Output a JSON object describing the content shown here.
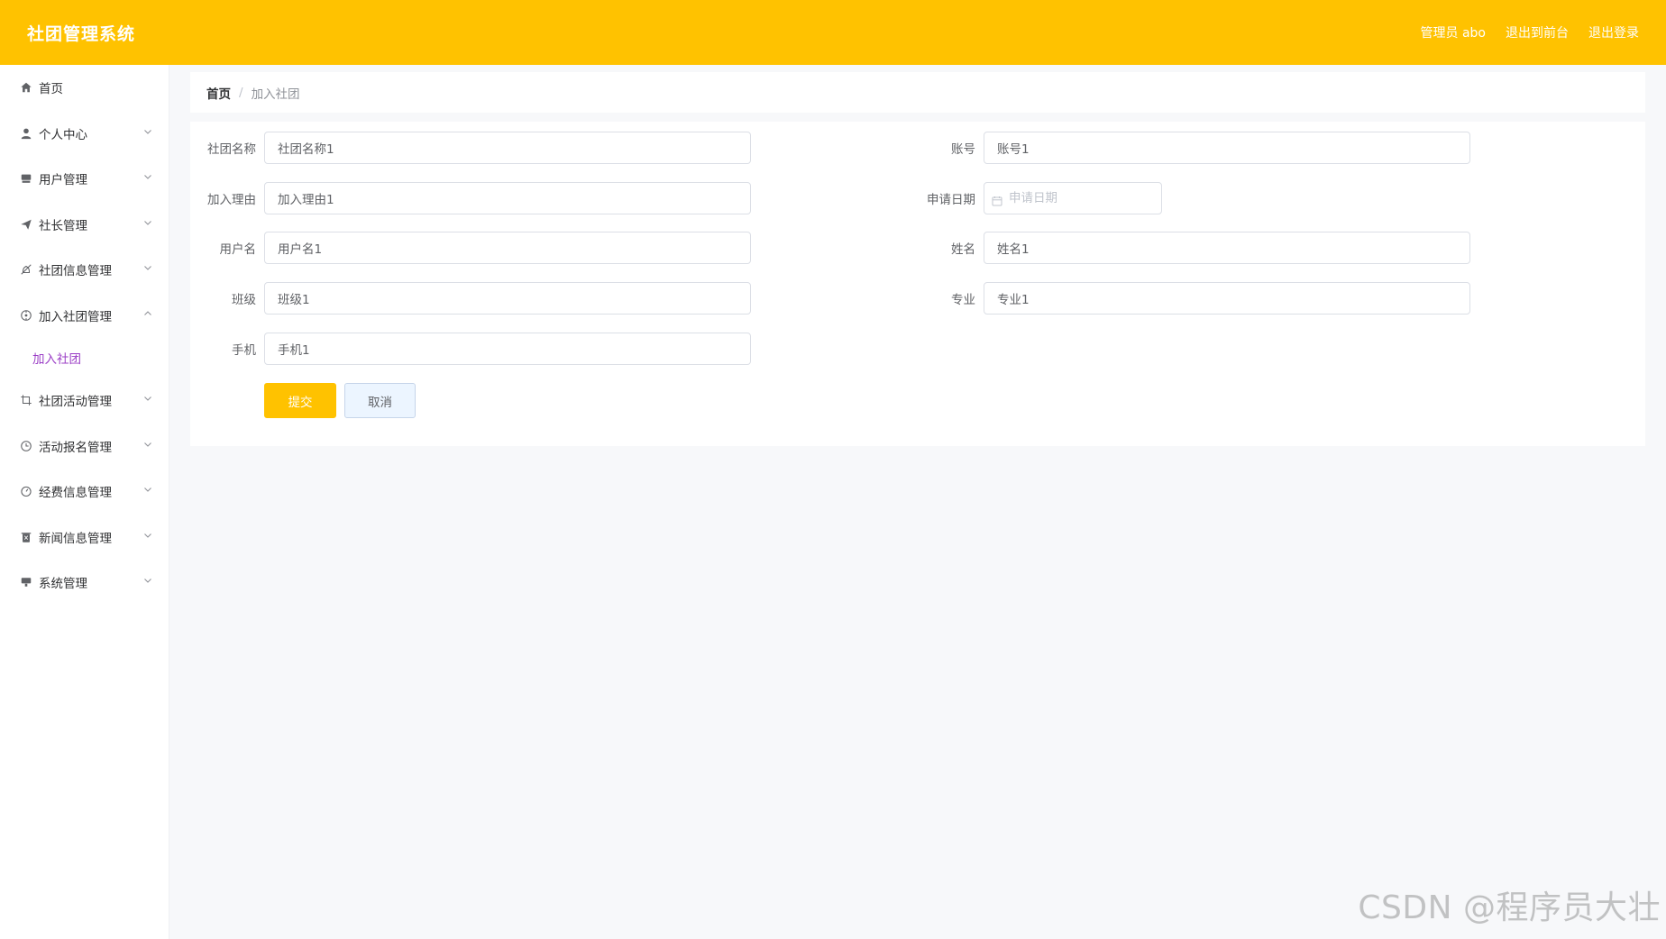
{
  "header": {
    "title": "社团管理系统",
    "user_label": "管理员 abo",
    "to_front_label": "退出到前台",
    "logout_label": "退出登录",
    "brand_color": "#ffc200"
  },
  "sidebar": {
    "items": [
      {
        "label": "首页",
        "icon": "home-icon",
        "expandable": false
      },
      {
        "label": "个人中心",
        "icon": "user-icon",
        "expandable": true
      },
      {
        "label": "用户管理",
        "icon": "folder-icon",
        "expandable": true
      },
      {
        "label": "社长管理",
        "icon": "send-icon",
        "expandable": true
      },
      {
        "label": "社团信息管理",
        "icon": "bell-off-icon",
        "expandable": true
      },
      {
        "label": "加入社团管理",
        "icon": "compass-icon",
        "expandable": true,
        "expanded": true,
        "children": [
          {
            "label": "加入社团",
            "active": true
          }
        ]
      },
      {
        "label": "社团活动管理",
        "icon": "crop-icon",
        "expandable": true
      },
      {
        "label": "活动报名管理",
        "icon": "clock-icon",
        "expandable": true
      },
      {
        "label": "经费信息管理",
        "icon": "stopwatch-icon",
        "expandable": true
      },
      {
        "label": "新闻信息管理",
        "icon": "delete-icon",
        "expandable": true
      },
      {
        "label": "系统管理",
        "icon": "monitor-icon",
        "expandable": true
      }
    ]
  },
  "breadcrumb": {
    "home": "首页",
    "separator": "/",
    "current": "加入社团"
  },
  "form": {
    "club_name": {
      "label": "社团名称",
      "value": "社团名称1"
    },
    "account": {
      "label": "账号",
      "value": "账号1"
    },
    "reason": {
      "label": "加入理由",
      "value": "加入理由1"
    },
    "apply_date": {
      "label": "申请日期",
      "value": "",
      "placeholder": "申请日期"
    },
    "username": {
      "label": "用户名",
      "value": "用户名1"
    },
    "real_name": {
      "label": "姓名",
      "value": "姓名1"
    },
    "class": {
      "label": "班级",
      "value": "班级1"
    },
    "major": {
      "label": "专业",
      "value": "专业1"
    },
    "phone": {
      "label": "手机",
      "value": "手机1"
    },
    "submit_label": "提交",
    "cancel_label": "取消"
  },
  "watermark": "CSDN @程序员大壮"
}
